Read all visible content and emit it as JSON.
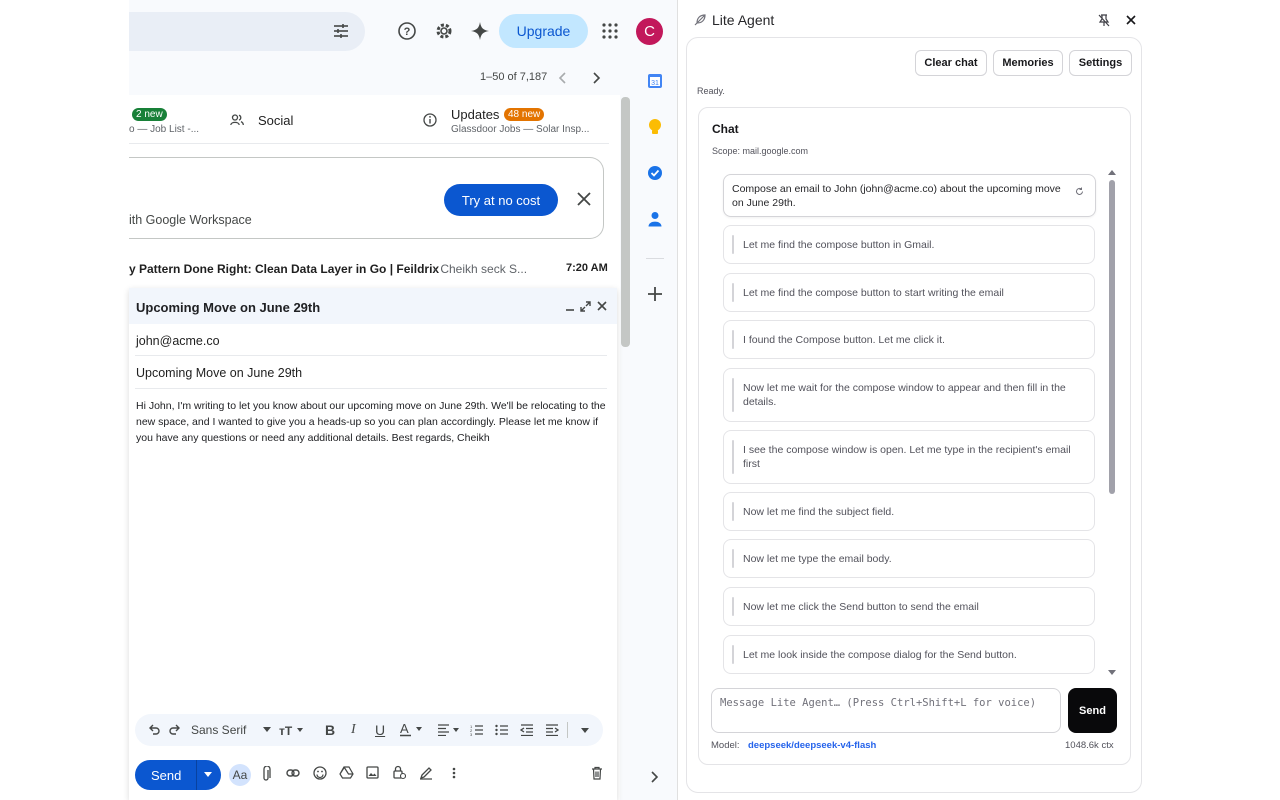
{
  "gmail": {
    "upgrade_label": "Upgrade",
    "avatar_letter": "C",
    "pagination": "1–50 of 7,187",
    "tabs": [
      {
        "badge": "2 new",
        "sub": "o — Job List -..."
      },
      {
        "label": "Social"
      },
      {
        "label": "Updates",
        "badge": "48 new",
        "sub": "Glassdoor Jobs — Solar Insp..."
      }
    ],
    "promo": {
      "text": "ith Google Workspace",
      "button": "Try at no cost"
    },
    "email_row": {
      "subject": "y Pattern Done Right: Clean Data Layer in Go | Feildrix",
      "snippet": " - Cheikh seck S...",
      "time": "7:20 AM"
    },
    "compose": {
      "title": "Upcoming Move on June 29th",
      "to": "john@acme.co",
      "subject": "Upcoming Move on June 29th",
      "body": "Hi John, I'm writing to let you know about our upcoming move on June 29th. We'll be relocating to the new space, and I wanted to give you a heads-up so you can plan accordingly. Please let me know if you have any questions or need any additional details. Best regards, Cheikh",
      "font_label": "Sans Serif",
      "send_label": "Send",
      "aa_label": "Aa"
    },
    "calendar_day": "31"
  },
  "agent": {
    "title": "Lite Agent",
    "buttons": {
      "clear": "Clear chat",
      "memories": "Memories",
      "settings": "Settings"
    },
    "status": "Ready.",
    "chat_title": "Chat",
    "scope": "Scope: mail.google.com",
    "user_message": "Compose an email to John (john@acme.co) about the upcoming move on June 29th.",
    "messages": [
      "Let me find the compose button in Gmail.",
      "Let me find the compose button to start writing the email",
      "I found the Compose button. Let me click it.",
      "Now let me wait for the compose window to appear and then fill in the details.",
      "I see the compose window is open. Let me type in the recipient's email first",
      "Now let me find the subject field.",
      "Now let me type the email body.",
      "Now let me click the Send button to send the email",
      "Let me look inside the compose dialog for the Send button."
    ],
    "input_placeholder": "Message Lite Agent… (Press Ctrl+Shift+L for voice)",
    "send_label": "Send",
    "model_label": "Model:",
    "model_name": "deepseek/deepseek-v4-flash",
    "context": "1048.6k ctx"
  }
}
